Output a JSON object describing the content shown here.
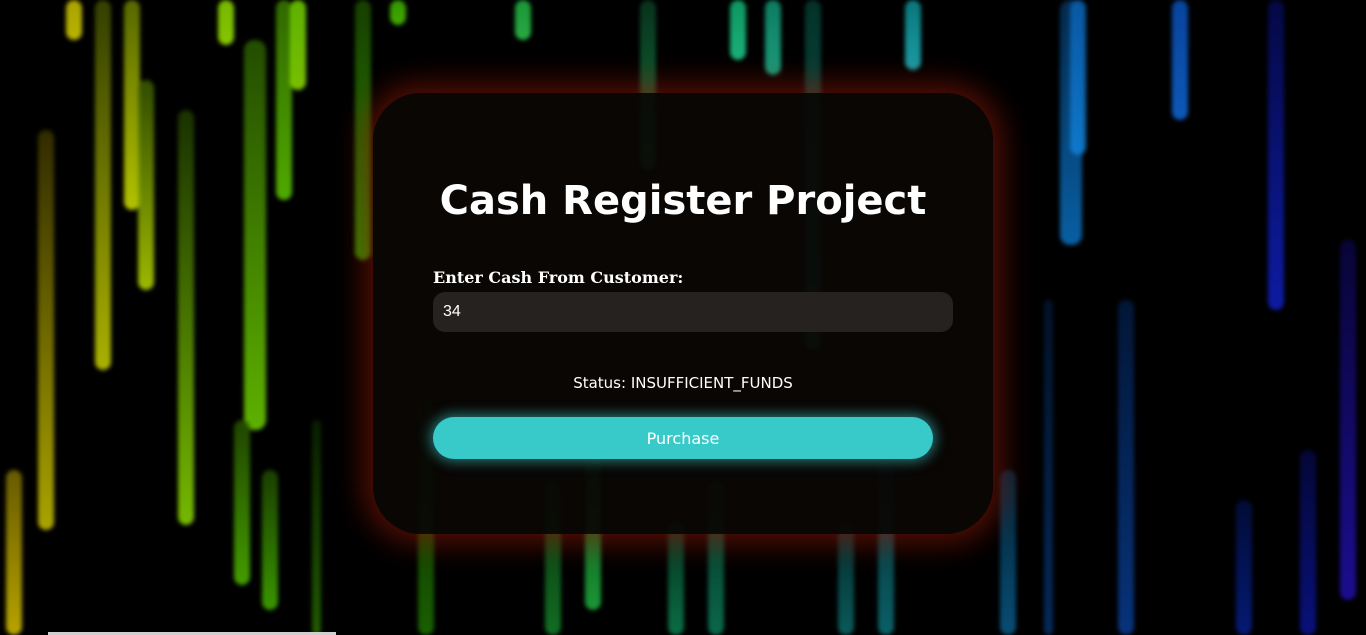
{
  "app": {
    "title": "Cash Register Project"
  },
  "form": {
    "cash_label": "Enter Cash From Customer:",
    "cash_value": "34",
    "status_label": "Status:",
    "status_value": "INSUFFICIENT_FUNDS",
    "purchase_label": "Purchase"
  },
  "theme": {
    "background": "#000000",
    "card_background": "#0a0604",
    "card_glow": "#961a0a",
    "input_background": "#262220",
    "button_color": "#38c9c9",
    "streak_colors": [
      "#c8c000",
      "#a8d000",
      "#70d000",
      "#30c000",
      "#00c080",
      "#00c0c0",
      "#0080e0",
      "#0040e0",
      "#2000d0"
    ]
  }
}
